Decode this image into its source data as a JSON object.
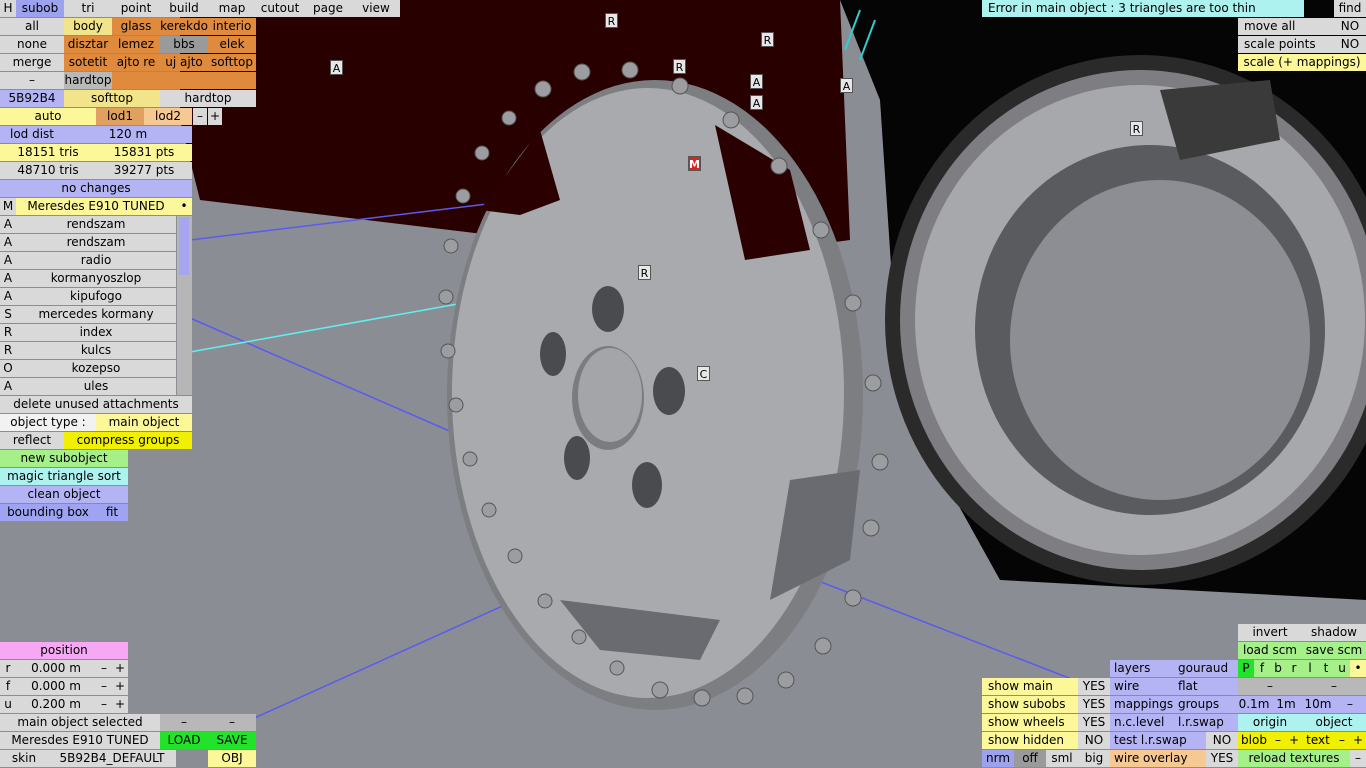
{
  "menu": {
    "tabs": [
      "H",
      "subob",
      "tri",
      "point",
      "build",
      "map",
      "cutout",
      "page",
      "view"
    ]
  },
  "groups": {
    "row1": [
      "all",
      "body",
      "glass",
      "kerekdo",
      "interio"
    ],
    "row2": [
      "none",
      "disztar",
      "lemez",
      "bbs",
      "elek"
    ],
    "row3": [
      "merge",
      "sotetit",
      "ajto re",
      "uj ajto",
      "softtop"
    ],
    "row4": [
      "–",
      "hardtop",
      "",
      ""
    ]
  },
  "color": {
    "code": "5B92B4",
    "softtop": "softtop",
    "hardtop": "hardtop"
  },
  "lod": {
    "auto": "auto",
    "lod1": "lod1",
    "lod2": "lod2",
    "minus": "–",
    "plus": "+",
    "dist_label": "lod dist",
    "dist_value": "120 m"
  },
  "stats": {
    "tris1": "18151 tris",
    "pts1": "15831 pts",
    "tris2": "48710 tris",
    "pts2": "39277 pts",
    "changes": "no changes"
  },
  "object": {
    "flag": "M",
    "name": "Meresdes E910 TUNED",
    "dot": "•"
  },
  "subobjects": [
    {
      "flag": "A",
      "name": "rendszam"
    },
    {
      "flag": "A",
      "name": "rendszam"
    },
    {
      "flag": "A",
      "name": "radio"
    },
    {
      "flag": "A",
      "name": "kormanyoszlop"
    },
    {
      "flag": "A",
      "name": "kipufogo"
    },
    {
      "flag": "S",
      "name": "mercedes kormany"
    },
    {
      "flag": "R",
      "name": "index"
    },
    {
      "flag": "R",
      "name": "kulcs"
    },
    {
      "flag": "O",
      "name": "kozepso"
    },
    {
      "flag": "A",
      "name": "ules"
    }
  ],
  "actions": {
    "delete_unused": "delete unused attachments",
    "object_type_label": "object type :",
    "object_type_value": "main object",
    "reflect": "reflect",
    "compress": "compress groups",
    "new_sub": "new subobject",
    "magic": "magic triangle sort",
    "clean": "clean object",
    "bbox": "bounding box",
    "fit": "fit"
  },
  "position": {
    "title": "position",
    "rows": [
      {
        "axis": "r",
        "value": "0.000 m"
      },
      {
        "axis": "f",
        "value": "0.000 m"
      },
      {
        "axis": "u",
        "value": "0.200 m"
      }
    ],
    "minus": "–",
    "plus": "+"
  },
  "bottom": {
    "selected": "main object selected",
    "dash": "–",
    "name": "Meresdes E910 TUNED",
    "load": "LOAD",
    "save": "SAVE",
    "skin_label": "skin",
    "skin_value": "5B92B4_DEFAULT",
    "obj": "OBJ"
  },
  "topright": {
    "error": "Error in main object : 3 triangles are too thin",
    "find": "find",
    "move_all": "move all",
    "scale_points": "scale points",
    "no": "NO",
    "scale_mappings": "scale (+ mappings)"
  },
  "br": {
    "invert": "invert",
    "shadow": "shadow",
    "load_scm": "load scm",
    "save_scm": "save scm",
    "flags": [
      "P",
      "f",
      "b",
      "r",
      "l",
      "t",
      "u",
      "•"
    ],
    "layers": "layers",
    "gouraud": "gouraud",
    "wire": "wire",
    "flat": "flat",
    "mappings": "mappings",
    "groups": "groups",
    "nclevel": "n.c.level",
    "lrswap": "l.r.swap",
    "test_lrswap": "test l.r.swap",
    "wire_overlay": "wire overlay",
    "show_main": "show main",
    "show_subobs": "show subobs",
    "show_wheels": "show wheels",
    "show_hidden": "show hidden",
    "yes": "YES",
    "no": "NO",
    "dash": "–",
    "s01": "0.1m",
    "s1": "1m",
    "s10": "10m",
    "origin": "origin",
    "object": "object",
    "blob": "blob",
    "text": "text",
    "plus": "+",
    "reload": "reload textures",
    "nrm": "nrm",
    "off": "off",
    "sml": "sml",
    "big": "big"
  },
  "markers": [
    "R",
    "R",
    "A",
    "R",
    "A",
    "A",
    "A",
    "R",
    "M",
    "R",
    "C"
  ]
}
